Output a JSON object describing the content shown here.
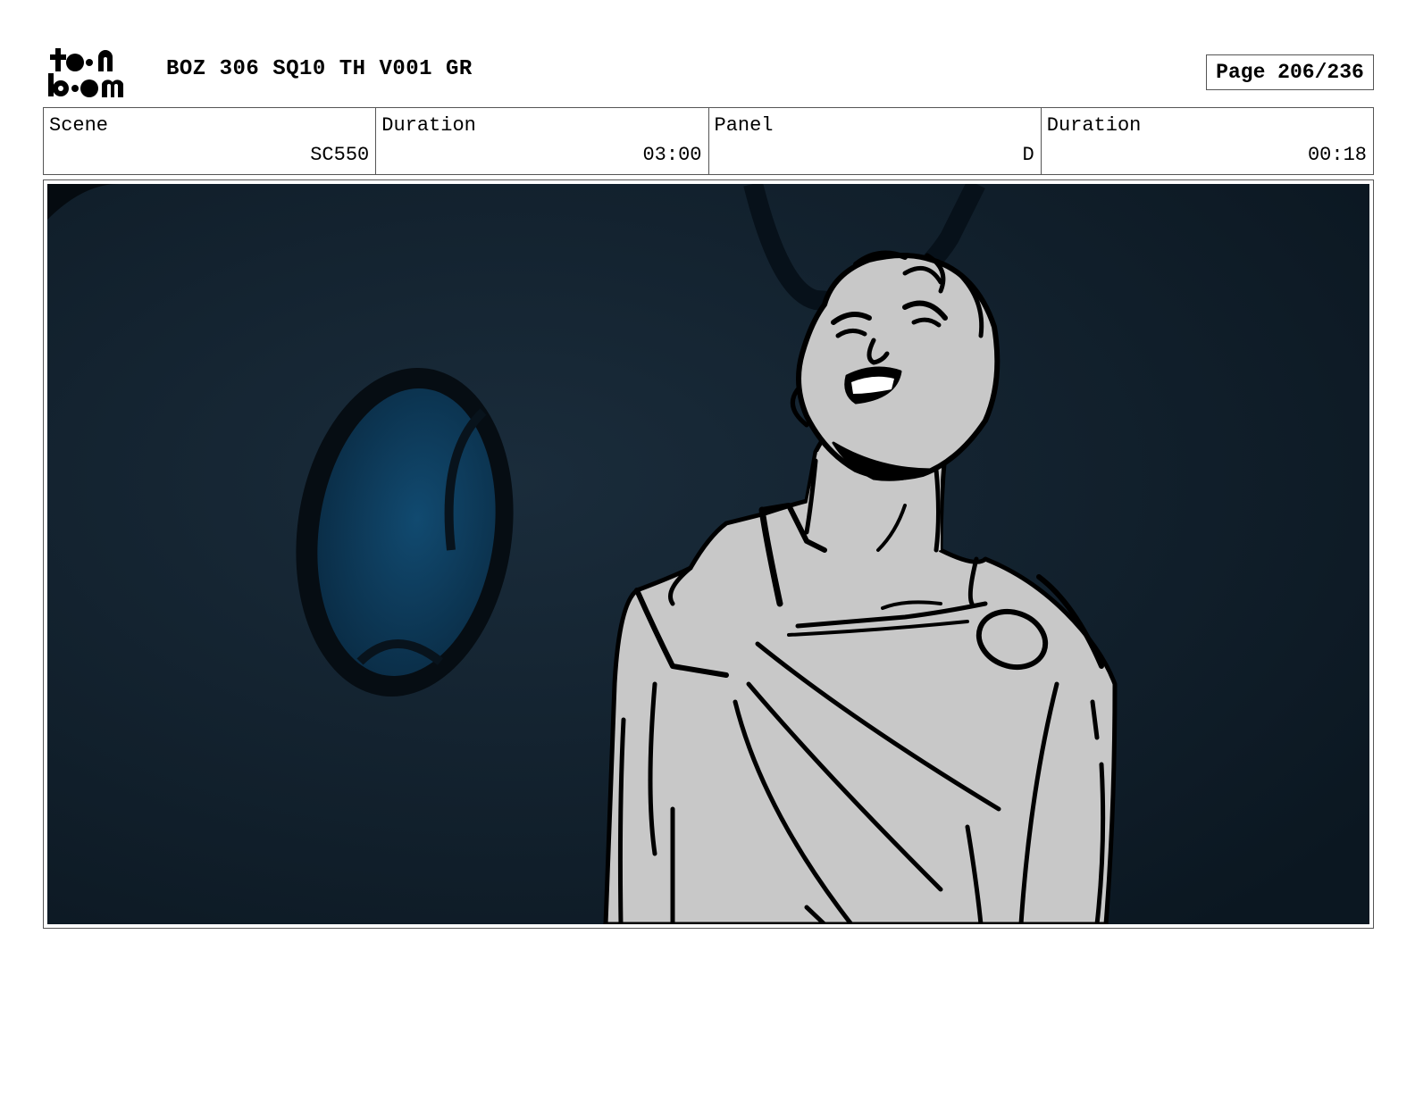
{
  "header": {
    "logo_text": "toon boom",
    "doc_title": "BOZ 306 SQ10 TH V001 GR",
    "page_label": "Page 206/236"
  },
  "info": {
    "scene_label": "Scene",
    "scene_value": "SC550",
    "scene_duration_label": "Duration",
    "scene_duration_value": "03:00",
    "panel_label": "Panel",
    "panel_value": "D",
    "panel_duration_label": "Duration",
    "panel_duration_value": "00:18"
  },
  "panel": {
    "colors": {
      "background": "#0f1c27",
      "porthole_glass": "#0e3a5a",
      "figure_fill": "#c8c8c8",
      "ink": "#000000"
    }
  }
}
